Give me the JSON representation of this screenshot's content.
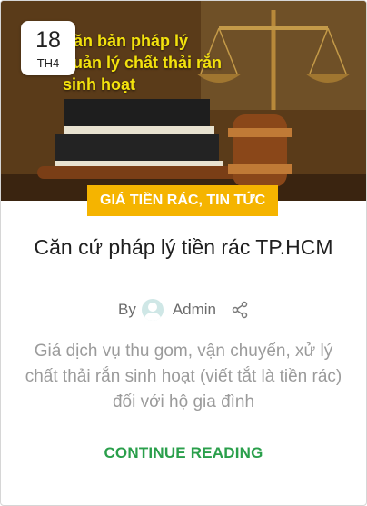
{
  "post": {
    "date_day": "18",
    "date_month": "TH4",
    "image_overlay_lines": [
      "Văn bản pháp lý",
      "quản lý chất thải rắn",
      "sinh hoạt"
    ],
    "category": "GIÁ TIỀN RÁC, TIN TỨC",
    "title": "Căn cứ pháp lý tiền rác TP.HCM",
    "by_label": "By",
    "author": "Admin",
    "excerpt": "Giá dịch vụ thu gom, vận chuyển, xử lý chất thải rắn sinh hoạt  (viết tắt là tiền rác) đối với hộ gia đình",
    "continue_label": "CONTINUE READING"
  },
  "icons": {
    "avatar": "user-avatar-icon",
    "share": "share-icon"
  },
  "colors": {
    "category_bg": "#f5b400",
    "continue_link": "#2a9f4b",
    "overlay_text": "#f3e20d"
  }
}
